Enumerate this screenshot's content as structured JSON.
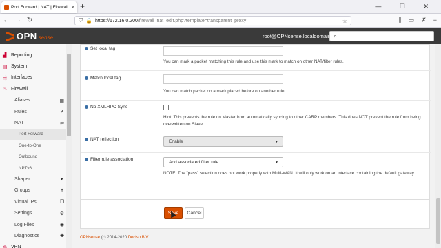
{
  "browser": {
    "tab_title": "Port Forward | NAT | Firewall | O",
    "url_host": "https://172.16.0.200",
    "url_path": "/firewall_nat_edit.php?template=transparent_proxy",
    "window_controls": "— ☐ ✕"
  },
  "header": {
    "logo_word": "OPN",
    "logo_suffix": "sense",
    "user": "root@OPNsense.localdomain",
    "search_icon": "search-icon"
  },
  "sidebar": {
    "items": [
      {
        "label": "Reporting",
        "level": 0,
        "icon": "chart-icon"
      },
      {
        "label": "System",
        "level": 0,
        "icon": "server-icon"
      },
      {
        "label": "Interfaces",
        "level": 0,
        "icon": "network-icon"
      },
      {
        "label": "Firewall",
        "level": 0,
        "icon": "fire-icon"
      },
      {
        "label": "Aliases",
        "level": 1,
        "right_icon": "list-icon"
      },
      {
        "label": "Rules",
        "level": 1,
        "right_icon": "check-icon"
      },
      {
        "label": "NAT",
        "level": 1,
        "right_icon": "exchange-icon"
      },
      {
        "label": "Port Forward",
        "level": 2,
        "active": true
      },
      {
        "label": "One-to-One",
        "level": 2
      },
      {
        "label": "Outbound",
        "level": 2
      },
      {
        "label": "NPTv6",
        "level": 2
      },
      {
        "label": "Shaper",
        "level": 1,
        "right_icon": "filter-icon"
      },
      {
        "label": "Groups",
        "level": 1,
        "right_icon": "sitemap-icon"
      },
      {
        "label": "Virtual IPs",
        "level": 1,
        "right_icon": "copy-icon"
      },
      {
        "label": "Settings",
        "level": 1,
        "right_icon": "cogs-icon"
      },
      {
        "label": "Log Files",
        "level": 1,
        "right_icon": "eye-icon"
      },
      {
        "label": "Diagnostics",
        "level": 1,
        "right_icon": "medkit-icon"
      },
      {
        "label": "VPN",
        "level": 0,
        "icon": "globe-icon"
      }
    ]
  },
  "form": {
    "set_local_tag": {
      "label": "Set local tag",
      "value": "",
      "hint": "You can mark a packet matching this rule and use this mark to match on other NAT/filter rules."
    },
    "match_local_tag": {
      "label": "Match local tag",
      "value": "",
      "hint": "You can match packet on a mark placed before on another rule."
    },
    "no_xmlrpc_sync": {
      "label": "No XMLRPC Sync",
      "checked": false,
      "hint": "Hint: This prevents the rule on Master from automatically syncing to other CARP members. This does NOT prevent the rule from being overwritten on Slave."
    },
    "nat_reflection": {
      "label": "NAT reflection",
      "selected": "Enable"
    },
    "filter_rule_association": {
      "label": "Filter rule association",
      "selected": "Add associated filter rule",
      "hint": "NOTE: The \"pass\" selection does not work properly with Multi-WAN. It will only work on an interface containing the default gateway."
    }
  },
  "buttons": {
    "save": "Save",
    "cancel": "Cancel"
  },
  "footer": {
    "brand": "OPNsense",
    "copyright": "(c) 2014-2020",
    "company": "Deciso B.V."
  },
  "colors": {
    "accent": "#d94f00",
    "header_bg": "#3a3a3a"
  }
}
